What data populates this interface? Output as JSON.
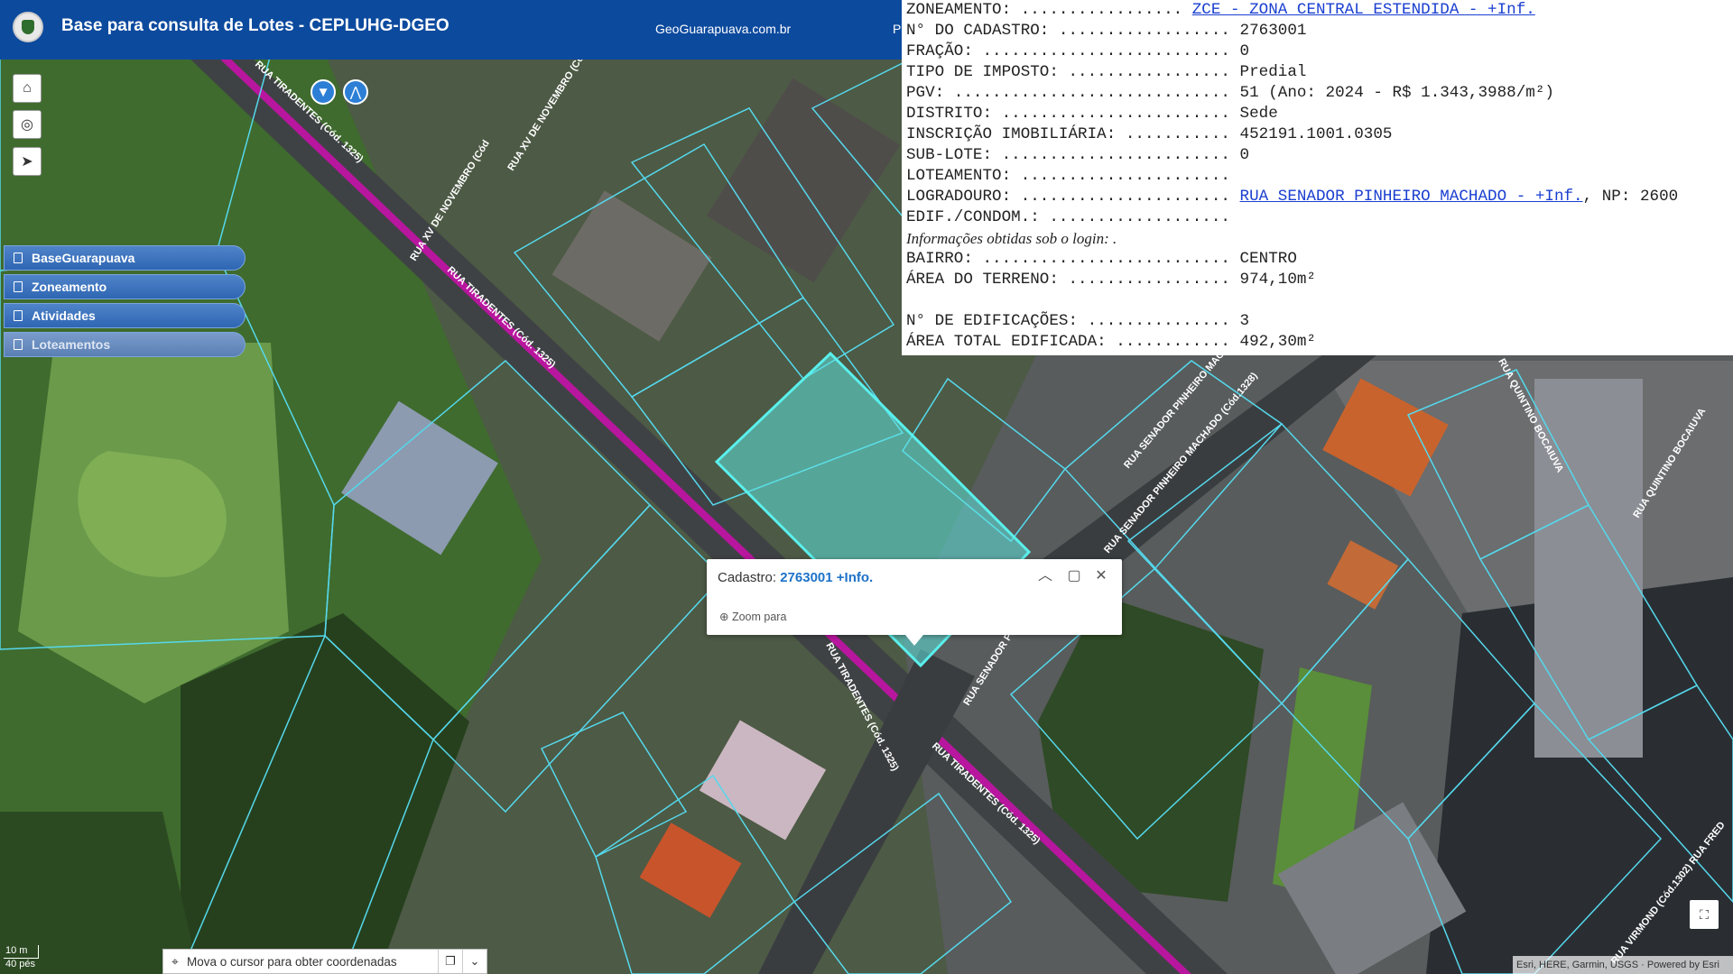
{
  "header": {
    "title": "Base para consulta de Lotes - CEPLUHG-DGEO",
    "link": "GeoGuarapuava.com.br",
    "link2": "P"
  },
  "map_controls": {
    "home_icon": "home-icon",
    "locate_icon": "locate-icon",
    "compass_icon": "compass-icon",
    "filter_icon": "filter-icon",
    "measure_icon": "measure-icon"
  },
  "layers": [
    {
      "label": "BaseGuarapuava"
    },
    {
      "label": "Zoneamento"
    },
    {
      "label": "Atividades"
    },
    {
      "label": "Loteamentos"
    }
  ],
  "info": {
    "zoneamento_label": "ZONEAMENTO: ................. ",
    "zoneamento_link": "ZCE - ZONA CENTRAL ESTENDIDA - +Inf.",
    "cadastro": "N° DO CADASTRO: .................. 2763001",
    "fracao": "FRAÇÃO: .......................... 0",
    "imposto": "TIPO DE IMPOSTO: ................. Predial",
    "pgv": "PGV: ............................. 51 (Ano: 2024 - R$ 1.343,3988/m²)",
    "distrito": "DISTRITO: ........................ Sede",
    "inscricao": "INSCRIÇÃO IMOBILIÁRIA: ........... 452191.1001.0305",
    "sublote": "SUB-LOTE: ........................ 0",
    "loteamento": "LOTEAMENTO: ......................",
    "logradouro_label": "LOGRADOURO: ...................... ",
    "logradouro_link": "RUA SENADOR PINHEIRO MACHADO - +Inf.",
    "logradouro_np": ", NP: 2600",
    "edif": "EDIF./CONDOM.: ...................",
    "note": "Informações obtidas sob o login: .",
    "bairro": "BAIRRO: .......................... CENTRO",
    "area_terreno": "ÁREA DO TERRENO: ................. 974,10m²",
    "blank": " ",
    "n_edificacoes": "N° DE EDIFICAÇÕES: ............... 3",
    "area_edificada": "ÁREA TOTAL EDIFICADA: ............ 492,30m²"
  },
  "popup": {
    "label": "Cadastro: ",
    "value": "2763001 +Info.",
    "zoom": "Zoom para"
  },
  "coords": {
    "text": "Mova o cursor para obter coordenadas"
  },
  "scale": {
    "metric": "10 m",
    "imperial": "40 pés"
  },
  "attribution": "Esri, HERE, Garmin, USGS · Powered by Esri",
  "street_labels": {
    "tiradentes_1": "RUA TIRADENTES (Cód. 1325)",
    "tiradentes_2": "RUA TIRADENTES (Cód. 1325)",
    "tiradentes_3": "RUA TIRADENTES (Cód. 1325)",
    "tiradentes_4": "RUA TIRADENTES (Cód. 1325)",
    "xv_novembro": "RUA XV DE NOVEMBRO (Cód",
    "xv_novembro_2": "RUA XV DE NOVEMBRO (Cód",
    "pinheiro": "RUA SENADOR PINHEIRO MACHADO (Cód.1328)",
    "pinheiro_2": "RUA SENADOR PINHEIRO MA",
    "pinheiro_3": "RUA SENADOR PINHEIRO MACHADO",
    "bocaiuva": "RUA QUINTINO BOCAIUVA",
    "bocaiuva_2": "RUA QUINTINO BOCAIUVA",
    "virmond": "RUA VIRMOND (Cód.1302) RUA FRED"
  }
}
